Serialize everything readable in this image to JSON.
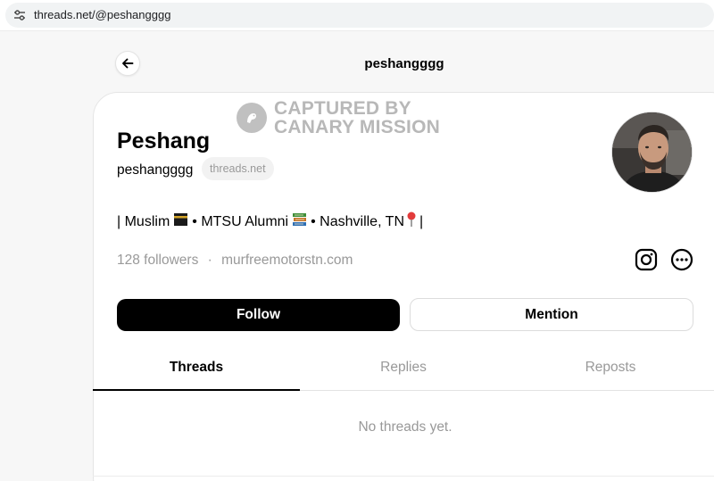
{
  "browser": {
    "url": "threads.net/@peshangggg"
  },
  "header": {
    "username": "peshangggg"
  },
  "watermark": {
    "line1": "CAPTURED BY",
    "line2": "CANARY MISSION"
  },
  "profile": {
    "name": "Peshang",
    "handle": "peshangggg",
    "domain_badge": "threads.net",
    "bio": {
      "seg1": "| Muslim",
      "seg2": "• MTSU Alumni",
      "seg3": "• Nashville, TN",
      "seg4": "|"
    },
    "followers": "128 followers",
    "separator": "·",
    "link": "murfreemotorstn.com"
  },
  "actions": {
    "follow": "Follow",
    "mention": "Mention"
  },
  "tabs": [
    "Threads",
    "Replies",
    "Reposts"
  ],
  "active_tab": "Threads",
  "empty_state": "No threads yet.",
  "icons": {
    "back": "back-arrow-icon",
    "instagram": "instagram-icon",
    "more": "more-options-icon",
    "site_settings": "tune-icon"
  },
  "colors": {
    "accent": "#000000",
    "muted": "#999999"
  }
}
